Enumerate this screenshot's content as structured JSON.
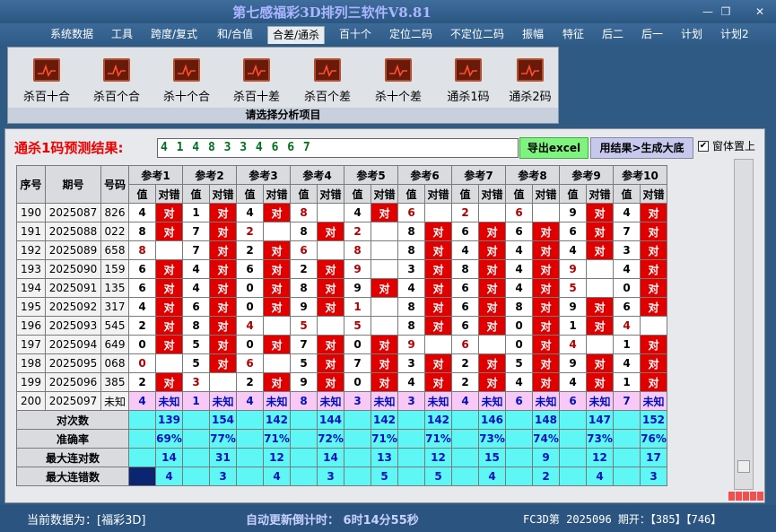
{
  "app": {
    "title": "第七感福彩3D排列三软件V8.81",
    "min": "—",
    "max": "❐",
    "close": "✕"
  },
  "menu": [
    "系统数据",
    "工具",
    "跨度/复式",
    "和/合值",
    "合差/通杀",
    "百十个",
    "定位二码",
    "不定位二码",
    "振幅",
    "特征",
    "后二",
    "后一",
    "计划",
    "计划2"
  ],
  "menu_active": 4,
  "ribbon": {
    "items": [
      "杀百十合",
      "杀百个合",
      "杀十个合",
      "杀百十差",
      "杀百个差",
      "杀十个差",
      "通杀1码",
      "通杀2码"
    ],
    "caption": "请选择分析项目"
  },
  "prediction": {
    "label": "通杀1码预测结果:",
    "value": "4 1 4 8 3 3 4 6 6 7"
  },
  "buttons": {
    "export": "导出excel",
    "generate": "用结果>生成大底"
  },
  "checkbox": {
    "label": "窗体置上",
    "checked": true
  },
  "table": {
    "h_seq": "序号",
    "h_period": "期号",
    "h_number": "号码",
    "refs": [
      "参考1",
      "参考2",
      "参考3",
      "参考4",
      "参考5",
      "参考6",
      "参考7",
      "参考8",
      "参考9",
      "参考10"
    ],
    "sub_val": "值",
    "sub_hit": "对错",
    "rows": [
      {
        "seq": "190",
        "period": "2025087",
        "num": "826",
        "cells": [
          [
            "4",
            "对"
          ],
          [
            "1",
            "对"
          ],
          [
            "4",
            "对"
          ],
          [
            "8",
            ""
          ],
          [
            "4",
            "对"
          ],
          [
            "6",
            ""
          ],
          [
            "2",
            ""
          ],
          [
            "6",
            ""
          ],
          [
            "9",
            "对"
          ],
          [
            "4",
            "对"
          ]
        ]
      },
      {
        "seq": "191",
        "period": "2025088",
        "num": "022",
        "cells": [
          [
            "8",
            "对"
          ],
          [
            "7",
            "对"
          ],
          [
            "2",
            ""
          ],
          [
            "8",
            "对"
          ],
          [
            "2",
            ""
          ],
          [
            "8",
            "对"
          ],
          [
            "6",
            "对"
          ],
          [
            "6",
            "对"
          ],
          [
            "6",
            "对"
          ],
          [
            "7",
            "对"
          ]
        ]
      },
      {
        "seq": "192",
        "period": "2025089",
        "num": "658",
        "cells": [
          [
            "8",
            ""
          ],
          [
            "7",
            "对"
          ],
          [
            "2",
            "对"
          ],
          [
            "6",
            ""
          ],
          [
            "8",
            ""
          ],
          [
            "8",
            "对"
          ],
          [
            "4",
            "对"
          ],
          [
            "4",
            "对"
          ],
          [
            "4",
            "对"
          ],
          [
            "3",
            "对"
          ]
        ]
      },
      {
        "seq": "193",
        "period": "2025090",
        "num": "159",
        "cells": [
          [
            "6",
            "对"
          ],
          [
            "4",
            "对"
          ],
          [
            "6",
            "对"
          ],
          [
            "2",
            "对"
          ],
          [
            "9",
            ""
          ],
          [
            "3",
            "对"
          ],
          [
            "8",
            "对"
          ],
          [
            "4",
            "对"
          ],
          [
            "9",
            ""
          ],
          [
            "4",
            "对"
          ]
        ]
      },
      {
        "seq": "194",
        "period": "2025091",
        "num": "135",
        "cells": [
          [
            "6",
            "对"
          ],
          [
            "4",
            "对"
          ],
          [
            "0",
            "对"
          ],
          [
            "8",
            "对"
          ],
          [
            "9",
            "对"
          ],
          [
            "4",
            "对"
          ],
          [
            "6",
            "对"
          ],
          [
            "4",
            "对"
          ],
          [
            "5",
            ""
          ],
          [
            "0",
            "对"
          ]
        ]
      },
      {
        "seq": "195",
        "period": "2025092",
        "num": "317",
        "cells": [
          [
            "4",
            "对"
          ],
          [
            "6",
            "对"
          ],
          [
            "0",
            "对"
          ],
          [
            "9",
            "对"
          ],
          [
            "1",
            ""
          ],
          [
            "8",
            "对"
          ],
          [
            "6",
            "对"
          ],
          [
            "8",
            "对"
          ],
          [
            "9",
            "对"
          ],
          [
            "6",
            "对"
          ]
        ]
      },
      {
        "seq": "196",
        "period": "2025093",
        "num": "545",
        "cells": [
          [
            "2",
            "对"
          ],
          [
            "8",
            "对"
          ],
          [
            "4",
            ""
          ],
          [
            "5",
            ""
          ],
          [
            "5",
            ""
          ],
          [
            "8",
            "对"
          ],
          [
            "6",
            "对"
          ],
          [
            "0",
            "对"
          ],
          [
            "1",
            "对"
          ],
          [
            "4",
            ""
          ]
        ]
      },
      {
        "seq": "197",
        "period": "2025094",
        "num": "649",
        "cells": [
          [
            "0",
            "对"
          ],
          [
            "5",
            "对"
          ],
          [
            "0",
            "对"
          ],
          [
            "7",
            "对"
          ],
          [
            "0",
            "对"
          ],
          [
            "9",
            ""
          ],
          [
            "6",
            ""
          ],
          [
            "0",
            "对"
          ],
          [
            "4",
            ""
          ],
          [
            "1",
            "对"
          ]
        ]
      },
      {
        "seq": "198",
        "period": "2025095",
        "num": "068",
        "cells": [
          [
            "0",
            ""
          ],
          [
            "5",
            "对"
          ],
          [
            "6",
            ""
          ],
          [
            "5",
            "对"
          ],
          [
            "7",
            "对"
          ],
          [
            "3",
            "对"
          ],
          [
            "2",
            "对"
          ],
          [
            "5",
            "对"
          ],
          [
            "9",
            "对"
          ],
          [
            "4",
            "对"
          ]
        ]
      },
      {
        "seq": "199",
        "period": "2025096",
        "num": "385",
        "cells": [
          [
            "2",
            "对"
          ],
          [
            "3",
            ""
          ],
          [
            "2",
            "对"
          ],
          [
            "9",
            "对"
          ],
          [
            "0",
            "对"
          ],
          [
            "4",
            "对"
          ],
          [
            "2",
            "对"
          ],
          [
            "4",
            "对"
          ],
          [
            "4",
            "对"
          ],
          [
            "1",
            "对"
          ]
        ]
      }
    ],
    "unknown_row": {
      "seq": "200",
      "period": "2025097",
      "num": "未知",
      "vals": [
        "4",
        "1",
        "4",
        "8",
        "3",
        "3",
        "4",
        "6",
        "6",
        "7"
      ],
      "mark": "未知"
    },
    "stats": [
      {
        "label": "对次数",
        "vals": [
          "139",
          "154",
          "142",
          "144",
          "142",
          "142",
          "146",
          "148",
          "147",
          "152"
        ]
      },
      {
        "label": "准确率",
        "vals": [
          "69%",
          "77%",
          "71%",
          "72%",
          "71%",
          "71%",
          "73%",
          "74%",
          "73%",
          "76%"
        ]
      },
      {
        "label": "最大连对数",
        "vals": [
          "14",
          "31",
          "12",
          "14",
          "13",
          "12",
          "15",
          "9",
          "12",
          "17"
        ]
      },
      {
        "label": "最大连错数",
        "vals": [
          "4",
          "3",
          "4",
          "3",
          "5",
          "5",
          "4",
          "2",
          "4",
          "3"
        ]
      }
    ]
  },
  "status": {
    "current": "当前数据为：[福彩3D]",
    "countdown": "自动更新倒计时：  6时14分55秒",
    "draw": "FC3D第 2025096 期开：【385】【746】"
  },
  "colors": {
    "hit": "#e00000",
    "unknown": "#f8c8f6",
    "stat": "#5ff6f6",
    "prediction": "#007020"
  }
}
